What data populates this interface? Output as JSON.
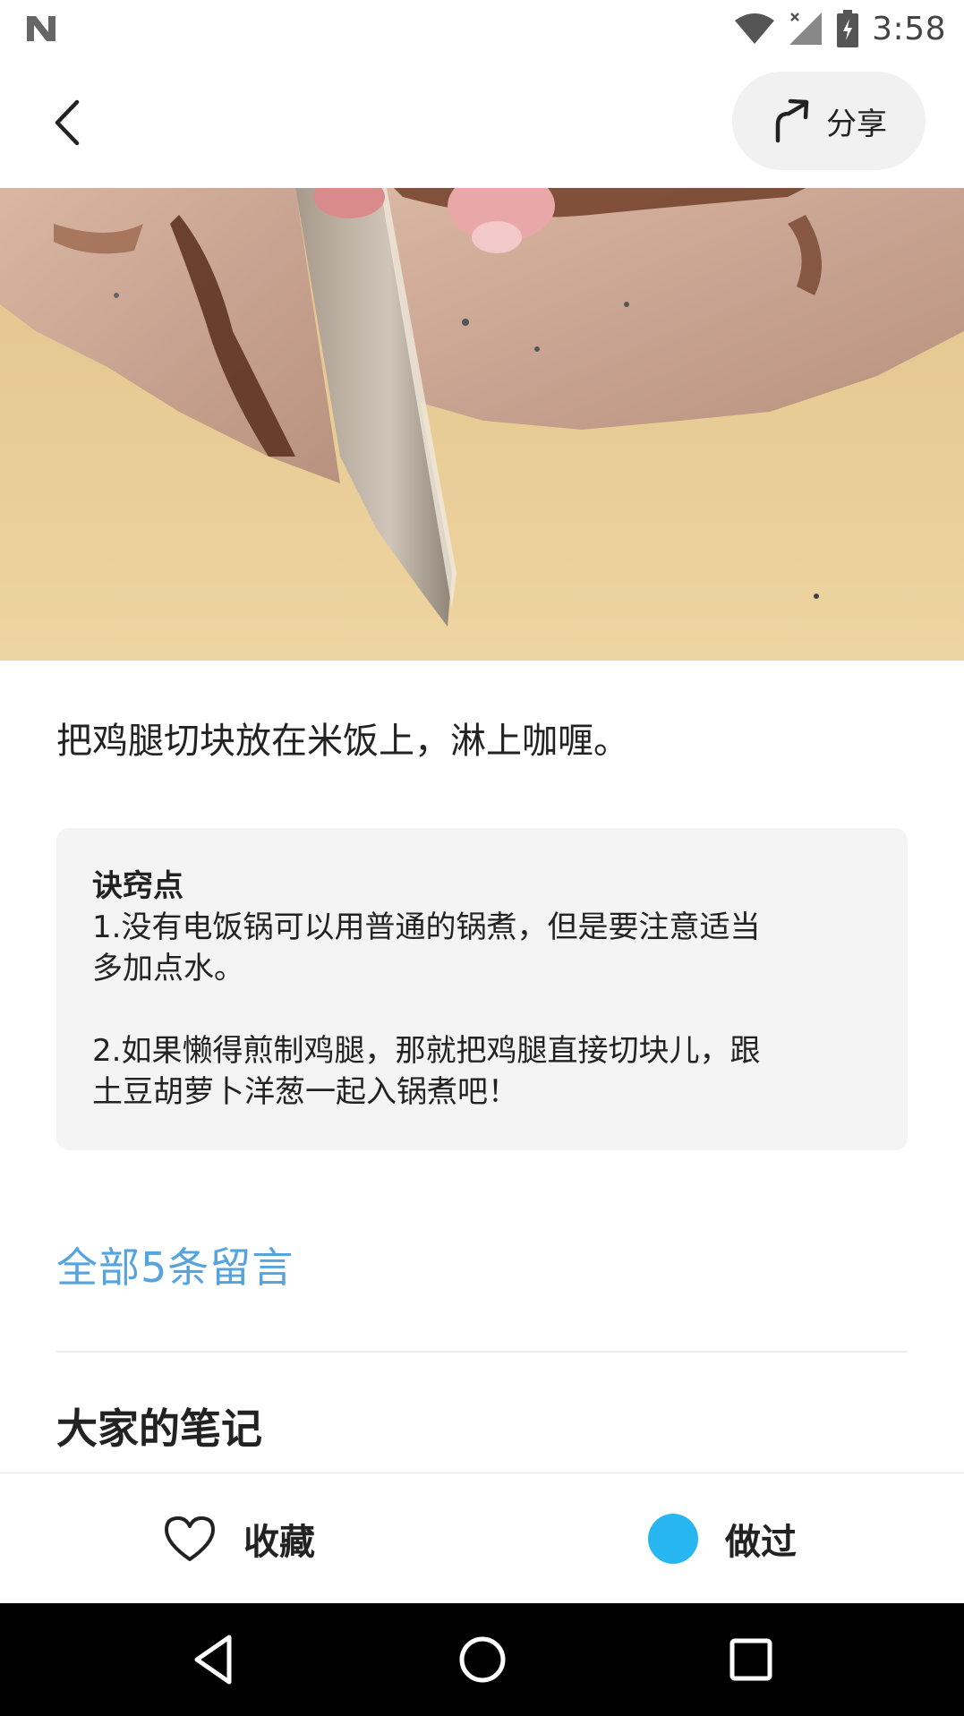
{
  "status_bar": {
    "time": "3:58"
  },
  "header": {
    "back_icon": "back-chevron-icon",
    "share_label": "分享",
    "share_icon": "share-arrow-icon"
  },
  "step": {
    "text": "把鸡腿切块放在米饭上，淋上咖喱。"
  },
  "tips": {
    "title": "诀窍点",
    "item1_line1": "1.没有电饭锅可以用普通的锅煮，但是要注意适当",
    "item1_line2": "多加点水。",
    "item2_line1": "2.如果懒得煎制鸡腿，那就把鸡腿直接切块儿，跟",
    "item2_line2": "土豆胡萝卜洋葱一起入锅煮吧！"
  },
  "comments": {
    "link_text": "全部5条留言"
  },
  "notes_section": {
    "title": "大家的笔记"
  },
  "action_bar": {
    "favorite_label": "收藏",
    "done_label": "做过",
    "accent_color": "#28b6f0"
  }
}
